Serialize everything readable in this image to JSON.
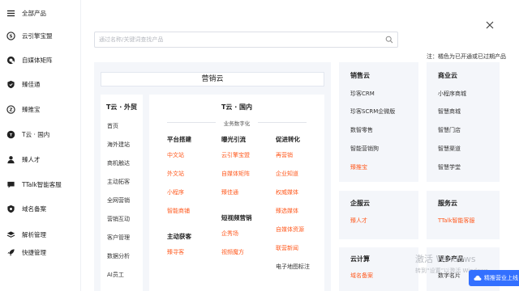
{
  "sidebar": {
    "items": [
      {
        "label": "全部产品",
        "icon": "menu-icon"
      },
      {
        "label": "云引擎宝盟",
        "icon": "cloud-engine-icon"
      },
      {
        "label": "自媒体矩阵",
        "icon": "media-matrix-icon"
      },
      {
        "label": "臻佳通",
        "icon": "shield-icon"
      },
      {
        "label": "臻推宝",
        "icon": "treasure-icon"
      },
      {
        "label": "T云 · 国内",
        "icon": "tcloud-icon"
      },
      {
        "label": "臻人才",
        "icon": "person-icon"
      },
      {
        "label": "TTalk智能客服",
        "icon": "chat-icon"
      },
      {
        "label": "域名备案",
        "icon": "domain-icon"
      },
      {
        "label": "解析管理",
        "icon": "layers-icon"
      },
      {
        "label": "快捷管理",
        "icon": "rocket-icon"
      }
    ]
  },
  "search": {
    "placeholder": "通过名称/关键词查找产品"
  },
  "note": "注：橘色为已开通或已过期产品",
  "marketing": {
    "banner": "营销云",
    "waimao": {
      "title": "T云 · 外贸",
      "items": [
        "首页",
        "海外建站",
        "商机触达",
        "主动拓客",
        "全网营销",
        "营销互动",
        "客户管理",
        "数据分析",
        "AI员工"
      ]
    },
    "guonei": {
      "title": "T云 · 国内",
      "subtitle": "业务数字化",
      "col1": {
        "head": "平台搭建",
        "items": [
          "中文站",
          "外文站",
          "小程序",
          "智能商铺"
        ],
        "head2": "主动获客",
        "items2": [
          "臻寻客"
        ]
      },
      "col2": {
        "head": "曝光引流",
        "items": [
          "云引擎宝盟",
          "自媒体矩阵",
          "臻佳通"
        ],
        "head2": "短视频营销",
        "items2": [
          "企秀场",
          "视频魔方"
        ]
      },
      "col3": {
        "head": "促进转化",
        "items": [
          "再营销",
          "企业知道",
          "权威媒体",
          "臻选媒体",
          "自媒体资源",
          "联营新闻"
        ],
        "extra": "电子地图标注"
      }
    }
  },
  "sales_cloud": {
    "title": "销售云",
    "items": [
      "珍客CRM",
      "珍客SCRM企微版",
      "数智零售",
      "智能营销狗"
    ],
    "active": "臻推宝"
  },
  "commerce_cloud": {
    "title": "商业云",
    "items": [
      "小程序商城",
      "智慧商城",
      "智慧门店",
      "智慧渠道",
      "智慧学堂"
    ]
  },
  "enterprise_cloud": {
    "title": "企服云",
    "active": "臻人才"
  },
  "service_cloud": {
    "title": "服务云",
    "active": "TTalk智能客服"
  },
  "compute_cloud": {
    "title": "云计算",
    "active": "域名备案"
  },
  "more_products": {
    "title": "更多产品",
    "item": "数字名片"
  },
  "watermark": {
    "line1": "激活 Windows",
    "line2": "转到“设置”以激活 Windows。"
  },
  "float_button": "精推营业上线"
}
